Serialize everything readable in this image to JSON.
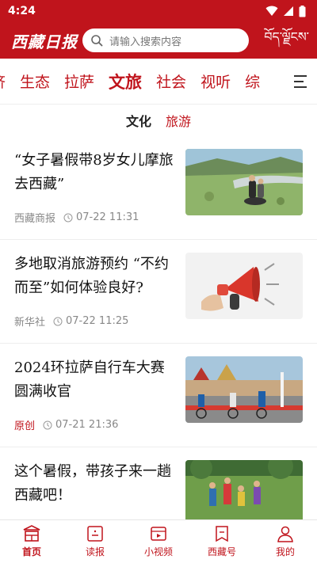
{
  "status_bar": {
    "time": "4:24"
  },
  "header": {
    "logo_text": "西藏日报",
    "search_placeholder": "请输入搜索内容",
    "tibetan_text": "བོད་ལྗོངས་"
  },
  "categories": [
    "济",
    "生态",
    "拉萨",
    "文旅",
    "社会",
    "视听",
    "综"
  ],
  "active_category": "文旅",
  "sub_tabs": {
    "culture": "文化",
    "travel": "旅游"
  },
  "news": [
    {
      "title": "“女子暑假带8岁女儿摩旅去西藏”",
      "source": "西藏商报",
      "time": "07-22  11:31",
      "original": false
    },
    {
      "title": "多地取消旅游预约 “不约而至”如何体验良好?",
      "source": "新华社",
      "time": "07-22  11:25",
      "original": false
    },
    {
      "title": "2024环拉萨自行车大赛圆满收官",
      "source": "原创",
      "time": "07-21  21:36",
      "original": true
    },
    {
      "title": "这个暑假，带孩子来一趟西藏吧！",
      "source": "",
      "time": "",
      "original": false
    }
  ],
  "bottom_nav": [
    {
      "label": "首页",
      "icon": "home-icon",
      "active": true
    },
    {
      "label": "读报",
      "icon": "newspaper-icon",
      "active": false
    },
    {
      "label": "小视频",
      "icon": "video-icon",
      "active": false
    },
    {
      "label": "西藏号",
      "icon": "bookmark-icon",
      "active": false
    },
    {
      "label": "我的",
      "icon": "user-icon",
      "active": false
    }
  ],
  "colors": {
    "brand_red": "#c0141c"
  }
}
